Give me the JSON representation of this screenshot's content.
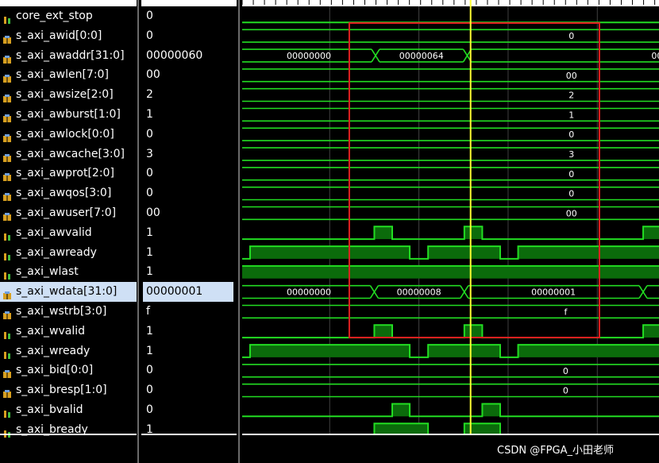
{
  "signals": [
    {
      "name": "core_ext_stop",
      "value": "0",
      "icon": "bit-signal-icon"
    },
    {
      "name": "s_axi_awid[0:0]",
      "value": "0",
      "icon": "bus-signal-icon"
    },
    {
      "name": "s_axi_awaddr[31:0]",
      "value": "00000060",
      "icon": "bus-signal-icon"
    },
    {
      "name": "s_axi_awlen[7:0]",
      "value": "00",
      "icon": "bus-signal-icon"
    },
    {
      "name": "s_axi_awsize[2:0]",
      "value": "2",
      "icon": "bus-signal-icon"
    },
    {
      "name": "s_axi_awburst[1:0]",
      "value": "1",
      "icon": "bus-signal-icon"
    },
    {
      "name": "s_axi_awlock[0:0]",
      "value": "0",
      "icon": "bus-signal-icon"
    },
    {
      "name": "s_axi_awcache[3:0]",
      "value": "3",
      "icon": "bus-signal-icon"
    },
    {
      "name": "s_axi_awprot[2:0]",
      "value": "0",
      "icon": "bus-signal-icon"
    },
    {
      "name": "s_axi_awqos[3:0]",
      "value": "0",
      "icon": "bus-signal-icon"
    },
    {
      "name": "s_axi_awuser[7:0]",
      "value": "00",
      "icon": "bus-signal-icon"
    },
    {
      "name": "s_axi_awvalid",
      "value": "1",
      "icon": "bit-signal-icon"
    },
    {
      "name": "s_axi_awready",
      "value": "1",
      "icon": "bit-signal-icon"
    },
    {
      "name": "s_axi_wlast",
      "value": "1",
      "icon": "bit-signal-icon"
    },
    {
      "name": "s_axi_wdata[31:0]",
      "value": "00000001",
      "icon": "bus-signal-icon",
      "selected": true
    },
    {
      "name": "s_axi_wstrb[3:0]",
      "value": "f",
      "icon": "bus-signal-icon"
    },
    {
      "name": "s_axi_wvalid",
      "value": "1",
      "icon": "bit-signal-icon"
    },
    {
      "name": "s_axi_wready",
      "value": "1",
      "icon": "bit-signal-icon"
    },
    {
      "name": "s_axi_bid[0:0]",
      "value": "0",
      "icon": "bus-signal-icon"
    },
    {
      "name": "s_axi_bresp[1:0]",
      "value": "0",
      "icon": "bus-signal-icon"
    },
    {
      "name": "s_axi_bvalid",
      "value": "0",
      "icon": "bit-signal-icon"
    },
    {
      "name": "s_axi_bready",
      "value": "1",
      "icon": "bit-signal-icon"
    }
  ],
  "waves": [
    {
      "type": "bit",
      "segments": [
        [
          0,
          1000,
          0
        ]
      ]
    },
    {
      "type": "bus",
      "labels": [
        {
          "t": 790,
          "text": "0"
        }
      ]
    },
    {
      "type": "bus",
      "transitions": [
        320,
        540
      ],
      "labels": [
        {
          "t": 160,
          "text": "00000000"
        },
        {
          "t": 430,
          "text": "00000064"
        },
        {
          "t": 995,
          "text": "00"
        }
      ]
    },
    {
      "type": "bus",
      "labels": [
        {
          "t": 790,
          "text": "00"
        }
      ]
    },
    {
      "type": "bus",
      "labels": [
        {
          "t": 790,
          "text": "2"
        }
      ]
    },
    {
      "type": "bus",
      "labels": [
        {
          "t": 790,
          "text": "1"
        }
      ]
    },
    {
      "type": "bus",
      "labels": [
        {
          "t": 790,
          "text": "0"
        }
      ]
    },
    {
      "type": "bus",
      "labels": [
        {
          "t": 790,
          "text": "3"
        }
      ]
    },
    {
      "type": "bus",
      "labels": [
        {
          "t": 790,
          "text": "0"
        }
      ]
    },
    {
      "type": "bus",
      "labels": [
        {
          "t": 790,
          "text": "0"
        }
      ]
    },
    {
      "type": "bus",
      "labels": [
        {
          "t": 790,
          "text": "00"
        }
      ]
    },
    {
      "type": "bit",
      "segments": [
        [
          0,
          317,
          0
        ],
        [
          317,
          360,
          1
        ],
        [
          360,
          533,
          0
        ],
        [
          533,
          576,
          1
        ],
        [
          576,
          962,
          0
        ],
        [
          962,
          1000,
          1
        ]
      ]
    },
    {
      "type": "bit",
      "segments": [
        [
          0,
          19,
          0
        ],
        [
          19,
          402,
          1
        ],
        [
          402,
          446,
          0
        ],
        [
          446,
          619,
          1
        ],
        [
          619,
          662,
          0
        ],
        [
          662,
          1000,
          1
        ]
      ]
    },
    {
      "type": "bit",
      "segments": [
        [
          0,
          1000,
          1
        ]
      ]
    },
    {
      "type": "bus",
      "transitions": [
        317,
        533,
        962
      ],
      "labels": [
        {
          "t": 160,
          "text": "00000000"
        },
        {
          "t": 424,
          "text": "00000008"
        },
        {
          "t": 747,
          "text": "00000001"
        }
      ]
    },
    {
      "type": "bus",
      "labels": [
        {
          "t": 776,
          "text": "f"
        }
      ]
    },
    {
      "type": "bit",
      "segments": [
        [
          0,
          317,
          0
        ],
        [
          317,
          360,
          1
        ],
        [
          360,
          533,
          0
        ],
        [
          533,
          576,
          1
        ],
        [
          576,
          962,
          0
        ],
        [
          962,
          1000,
          1
        ]
      ]
    },
    {
      "type": "bit",
      "segments": [
        [
          0,
          19,
          0
        ],
        [
          19,
          402,
          1
        ],
        [
          402,
          446,
          0
        ],
        [
          446,
          619,
          1
        ],
        [
          619,
          662,
          0
        ],
        [
          662,
          1000,
          1
        ]
      ]
    },
    {
      "type": "bus",
      "labels": [
        {
          "t": 776,
          "text": "0"
        }
      ]
    },
    {
      "type": "bus",
      "labels": [
        {
          "t": 776,
          "text": "0"
        }
      ]
    },
    {
      "type": "bit",
      "segments": [
        [
          0,
          360,
          0
        ],
        [
          360,
          402,
          1
        ],
        [
          402,
          576,
          0
        ],
        [
          576,
          619,
          1
        ],
        [
          619,
          1000,
          0
        ]
      ]
    },
    {
      "type": "bit",
      "segments": [
        [
          0,
          317,
          0
        ],
        [
          317,
          446,
          1
        ],
        [
          446,
          533,
          0
        ],
        [
          533,
          619,
          1
        ],
        [
          619,
          1000,
          0
        ]
      ]
    }
  ],
  "timeline": {
    "grid_t": [
      210,
      424,
      638,
      852
    ],
    "cursor_t": 548,
    "selection_t": [
      257,
      857
    ]
  },
  "colors": {
    "wave": "#22dd22",
    "grid": "#404040",
    "cursor": "#ffff33",
    "selection": "#e02020",
    "selected_row": "#cfe0f5"
  },
  "watermark": "CSDN @FPGA_小田老师"
}
